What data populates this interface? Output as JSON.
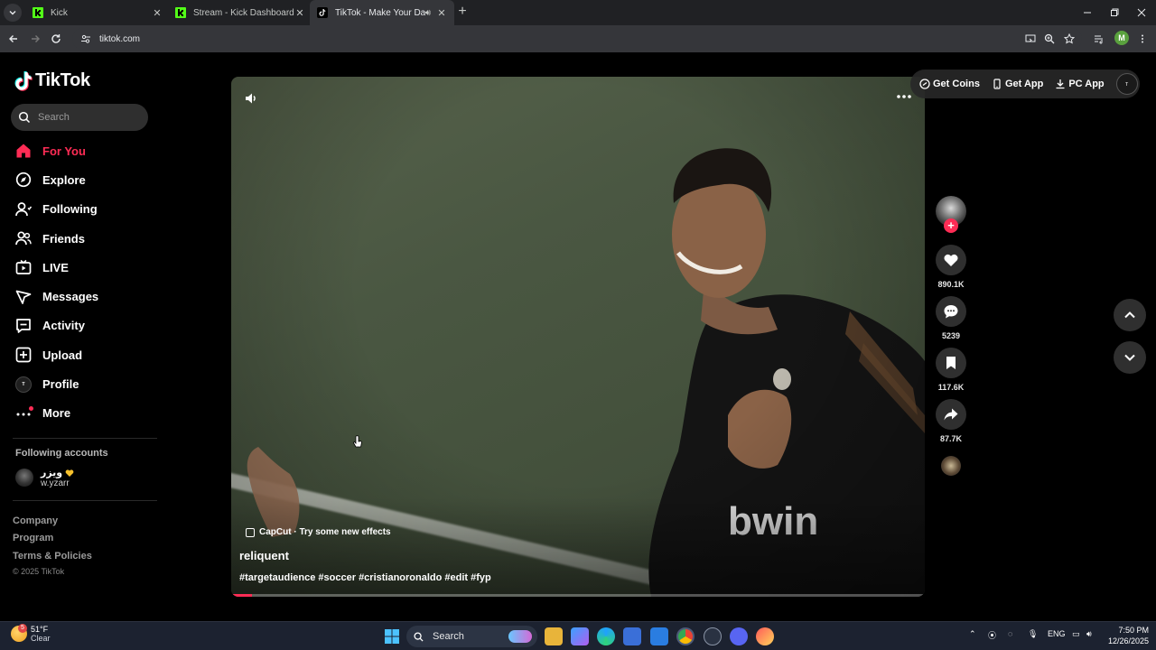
{
  "browser": {
    "tabs": [
      {
        "title": "Kick",
        "active": false
      },
      {
        "title": "Stream - Kick Dashboard",
        "active": false
      },
      {
        "title": "TikTok - Make Your Day",
        "active": true
      }
    ],
    "url": "tiktok.com",
    "profile_initial": "M"
  },
  "sidebar": {
    "logo_text": "TikTok",
    "search_placeholder": "Search",
    "nav": [
      {
        "label": "For You",
        "icon": "home-icon",
        "active": true
      },
      {
        "label": "Explore",
        "icon": "compass-icon"
      },
      {
        "label": "Following",
        "icon": "following-icon"
      },
      {
        "label": "Friends",
        "icon": "friends-icon"
      },
      {
        "label": "LIVE",
        "icon": "live-icon"
      },
      {
        "label": "Messages",
        "icon": "messages-icon"
      },
      {
        "label": "Activity",
        "icon": "activity-icon"
      },
      {
        "label": "Upload",
        "icon": "upload-icon"
      },
      {
        "label": "Profile",
        "icon": "profile-avatar"
      },
      {
        "label": "More",
        "icon": "more-icon"
      }
    ],
    "following_accounts_title": "Following accounts",
    "following_accounts": [
      {
        "name": "ويزر",
        "handle": "w.yzarr"
      }
    ],
    "footer_links": [
      "Company",
      "Program",
      "Terms & Policies"
    ],
    "copyright": "© 2025 TikTok"
  },
  "topbar": {
    "get_coins": "Get Coins",
    "get_app": "Get App",
    "pc_app": "PC App"
  },
  "video": {
    "effect_label": "CapCut · Try some new effects",
    "author": "reliquent",
    "hashtags": "#targetaudience #soccer #cristianoronaldo #edit #fyp",
    "progress": 0.03,
    "jersey_text": "bwin"
  },
  "actions": {
    "likes": "890.1K",
    "comments": "5239",
    "saves": "117.6K",
    "shares": "87.7K"
  },
  "taskbar": {
    "temp": "51°F",
    "condition": "Clear",
    "weather_badge": "5",
    "search_label": "Search",
    "language": "ENG",
    "time": "7:50 PM",
    "date": "12/26/2025"
  },
  "colors": {
    "accent": "#fe2c55",
    "background": "#000000",
    "chrome": "#202124"
  }
}
